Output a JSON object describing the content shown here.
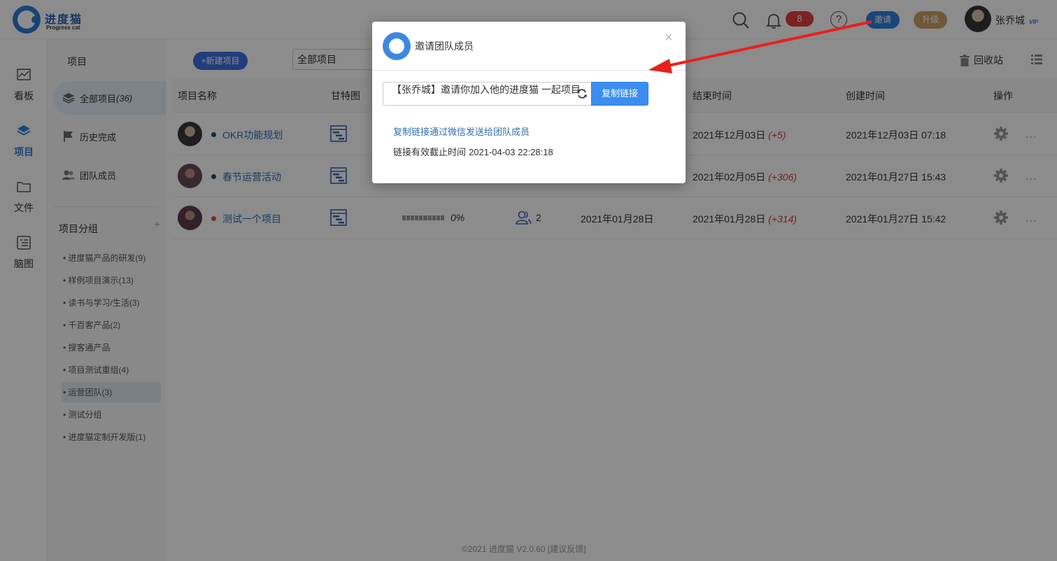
{
  "brand": {
    "name": "进度猫",
    "subtitle": "Progress cat"
  },
  "topbar": {
    "notification_count": "8",
    "help_label": "?",
    "invite_label": "邀请",
    "upgrade_label": "升级",
    "user_name": "张乔城",
    "vip_label": "VIP"
  },
  "leftnav": [
    {
      "label": "看板",
      "icon": "dashboard-icon"
    },
    {
      "label": "项目",
      "icon": "layers-icon",
      "active": true
    },
    {
      "label": "文件",
      "icon": "folder-icon"
    },
    {
      "label": "脑图",
      "icon": "mindmap-icon"
    }
  ],
  "sidebar": {
    "title": "项目",
    "menus": [
      {
        "label": "全部项目",
        "count": "(36)",
        "active": true
      },
      {
        "label": "历史完成"
      },
      {
        "label": "团队成员"
      }
    ],
    "group_title": "项目分组",
    "add_label": "+",
    "groups": [
      "• 进度猫产品的研发(9)",
      "• 样例项目演示(13)",
      "• 读书与学习/生活(3)",
      "• 千百客产品(2)",
      "• 搜客通产品",
      "• 项目测试重组(4)",
      "• 运营团队(3)",
      "• 测试分组",
      "• 进度猫定制开发版(1)"
    ]
  },
  "main": {
    "new_project_label": "+新建项目",
    "filter_value": "全部项目",
    "recycle_label": "回收站",
    "columns": {
      "name": "项目名称",
      "gantt": "甘特图",
      "end_time": "结束时间",
      "created_time": "创建时间",
      "actions": "操作"
    },
    "rows": [
      {
        "name": "OKR功能规划",
        "dot_color": "#1f4e6e",
        "end_date": "2021年12月03日",
        "end_delta": "(+5)",
        "created": "2021年12月03日 07:18"
      },
      {
        "name": "春节运营活动",
        "dot_color": "#1f4e6e",
        "end_date": "2021年02月05日",
        "end_delta": "(+306)",
        "created": "2021年01月27日 15:43"
      },
      {
        "name": "测试一个项目",
        "dot_color": "#e05050",
        "progress": "0%",
        "progress_value": 0,
        "members": "2",
        "start_date": "2021年01月28日",
        "end_date": "2021年01月28日",
        "end_delta": "(+314)",
        "created": "2021年01月27日 15:42"
      }
    ],
    "more_label": "...",
    "footer": "©2021 进度猫 V2.0.60 [建议反馈]"
  },
  "modal": {
    "title": "邀请团队成员",
    "close_label": "×",
    "invite_text": "【张乔城】邀请你加入他的进度猫 一起项目",
    "copy_button": "复制链接",
    "hint_link": "复制链接通过微信发送给团队成员",
    "expire_label": "链接有效截止时间",
    "expire_time": "2021-04-03 22:28:18"
  },
  "colors": {
    "accent": "#2f7fdc",
    "upgrade": "#c9a165",
    "badge": "#e03e3e",
    "annotation_arrow": "#e8201d"
  }
}
